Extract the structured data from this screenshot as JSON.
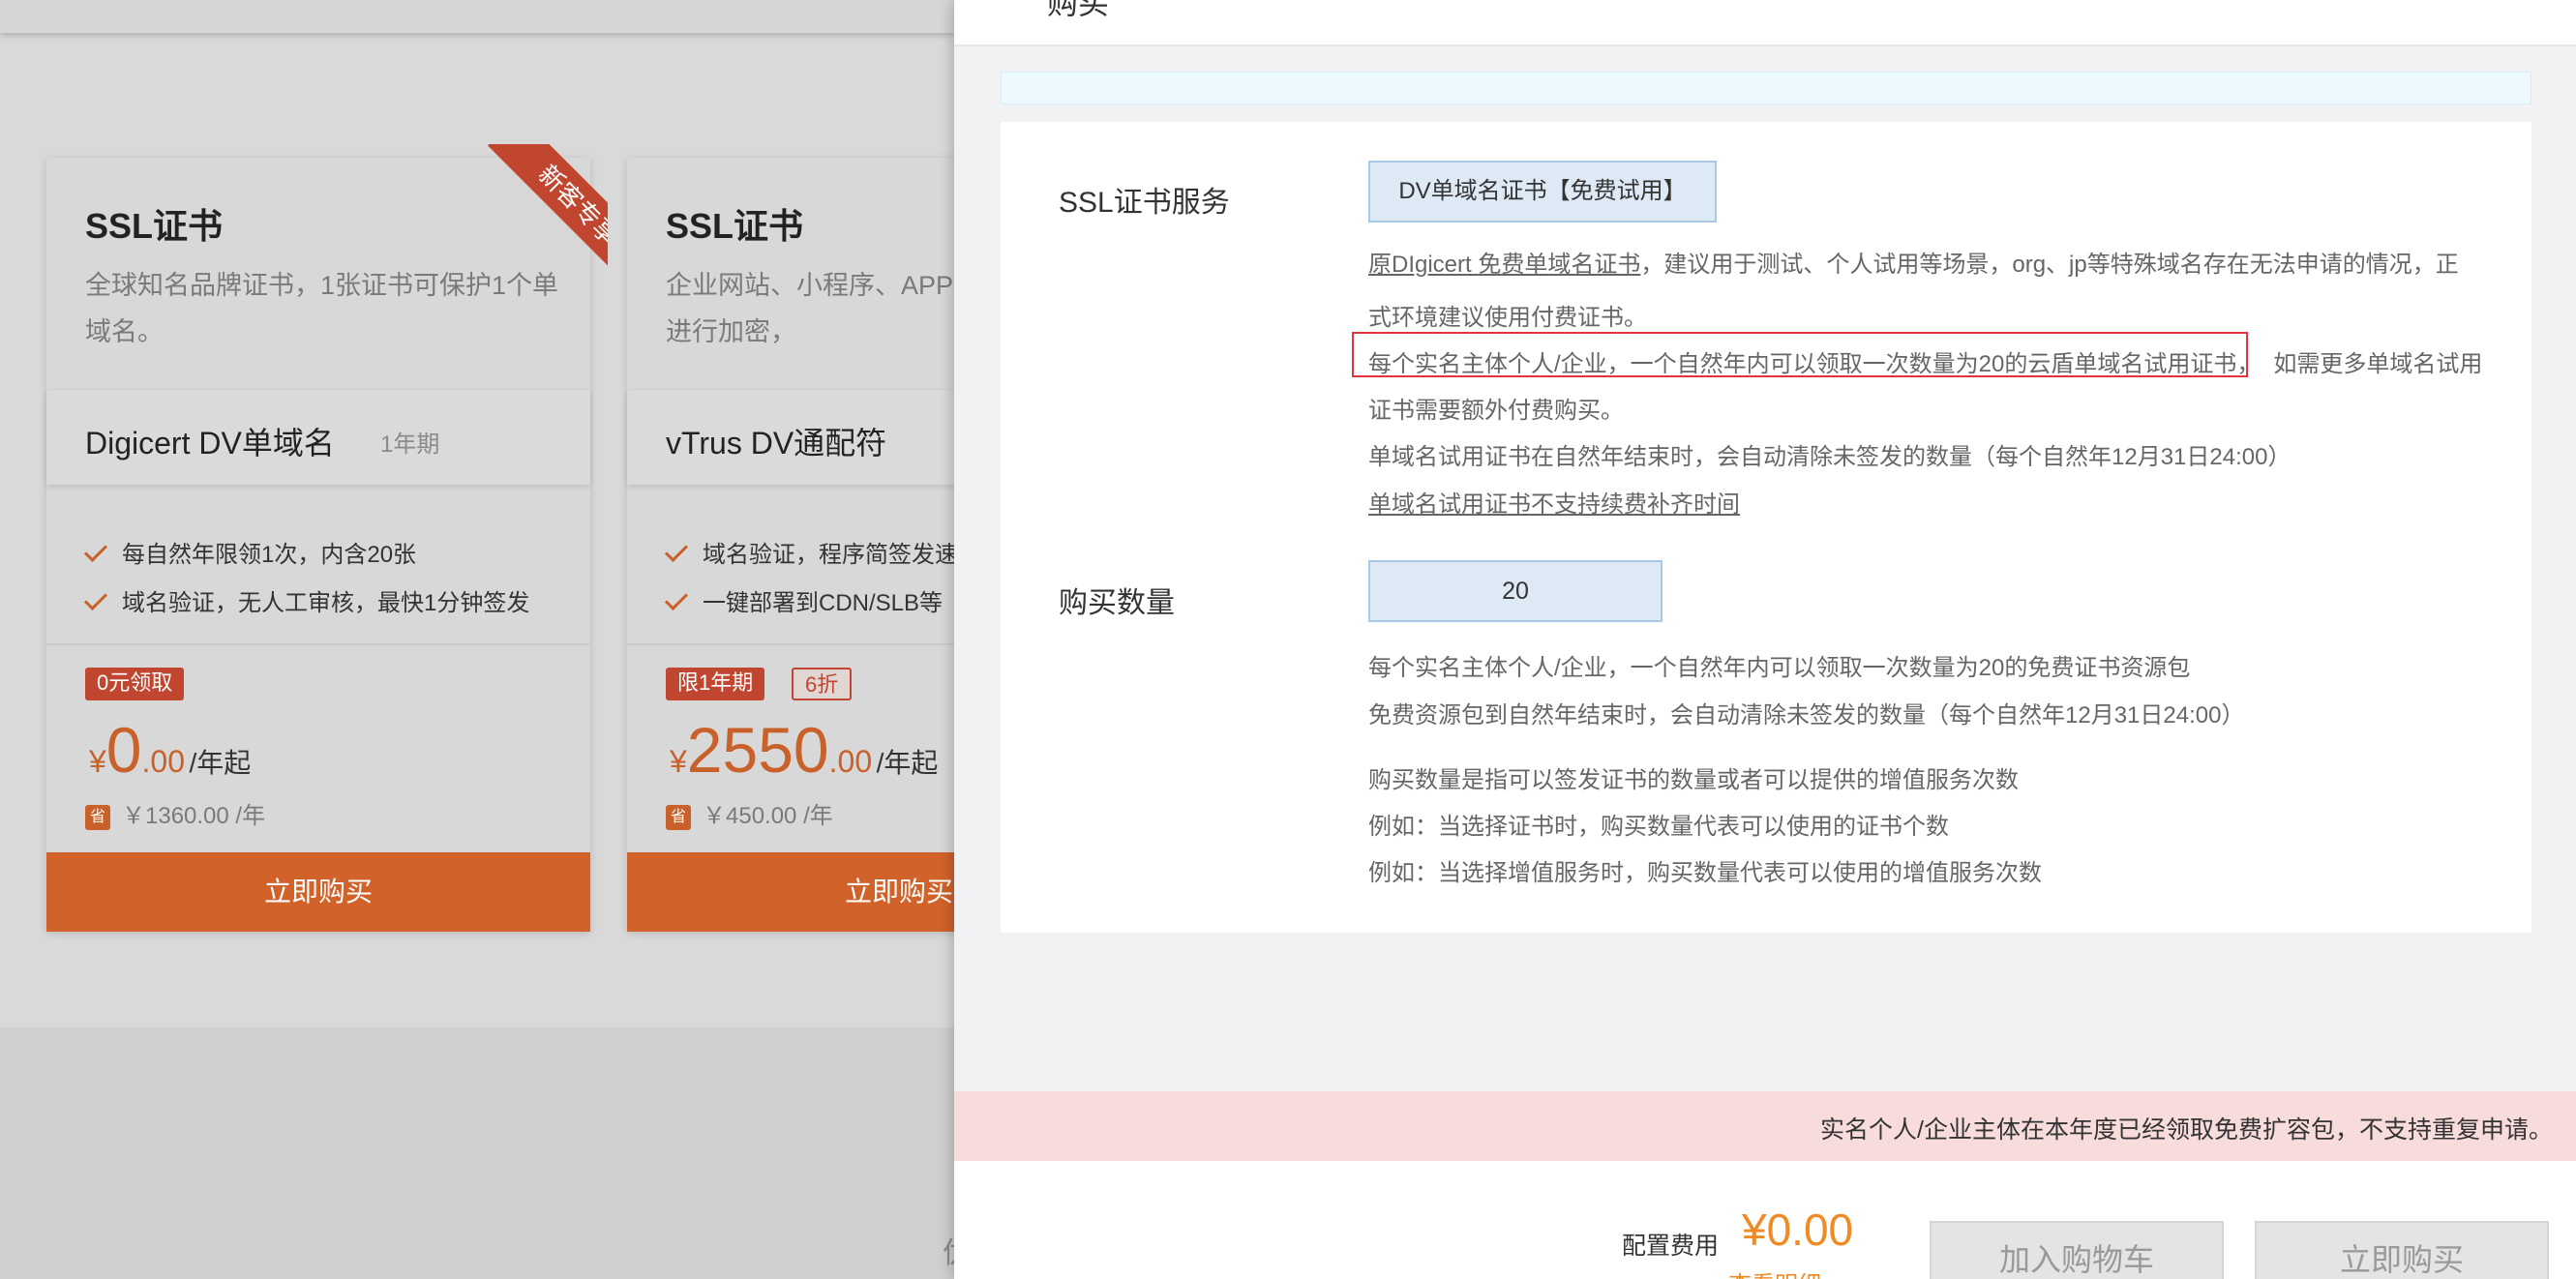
{
  "cards": [
    {
      "title": "SSL证书",
      "desc": "全球知名品牌证书，1张证书可保护1个单域名。",
      "ribbon": "新客专享",
      "product": "Digicert DV单域名",
      "period": "1年期",
      "features": [
        "每自然年限领1次，内含20张",
        "域名验证，无人工审核，最快1分钟签发"
      ],
      "badges": [
        "0元领取"
      ],
      "price_yen": "¥",
      "price_int": "0",
      "price_dec": ".00",
      "price_unit": "/年起",
      "save_icon": "省",
      "save_text": "￥1360.00 /年",
      "buy": "立即购买"
    },
    {
      "title": "SSL证书",
      "desc": "企业网站、小程序、APP 产品，对流量进行加密，",
      "product": "vTrus DV通配符",
      "features": [
        "域名验证，程序简签发速",
        "一键部署到CDN/SLB等"
      ],
      "badges": [
        "限1年期",
        "6折"
      ],
      "price_yen": "¥",
      "price_int": "2550",
      "price_dec": ".00",
      "price_unit": "/年起",
      "save_icon": "省",
      "save_text": "￥450.00 /年",
      "buy": "立即购买"
    }
  ],
  "bg_footer_char": "优",
  "drawer": {
    "title": "购买",
    "ssl_label": "SSL证书服务",
    "ssl_value": "DV单域名证书【免费试用】",
    "ssl_help": {
      "link": "原DIgicert 免费单域名证书",
      "line1_rest": "，建议用于测试、个人试用等场景，org、jp等特殊域名存在无法申请的情况，正",
      "line2": "式环境建议使用付费证书。",
      "line3_highlight": "每个实名主体个人/企业，一个自然年内可以领取一次数量为20的云盾单域名试用证书，",
      "line3_rest": "如需更多单域名试用",
      "line4": "证书需要额外付费购买。",
      "line5": "单域名试用证书在自然年结束时，会自动清除未签发的数量（每个自然年12月31日24:00）",
      "line6_link": "单域名试用证书不支持续费补齐时间"
    },
    "qty_label": "购买数量",
    "qty_value": "20",
    "qty_help": [
      "每个实名主体个人/企业，一个自然年内可以领取一次数量为20的免费证书资源包",
      "免费资源包到自然年结束时，会自动清除未签发的数量（每个自然年12月31日24:00）",
      "购买数量是指可以签发证书的数量或者可以提供的增值服务次数",
      "例如：当选择证书时，购买数量代表可以使用的证书个数",
      "例如：当选择增值服务时，购买数量代表可以使用的增值服务次数"
    ],
    "alert": "实名个人/企业主体在本年度已经领取免费扩容包，不支持重复申请。",
    "fee_label": "配置费用",
    "fee_amount": "¥0.00",
    "detail_link": "查看明细 ↓",
    "cart_button": "加入购物车",
    "buy_button": "立即购买"
  },
  "colors": {
    "accent_orange": "#d1622a",
    "badge_red": "#c14630",
    "fee_orange": "#f08a24",
    "alert_bg": "#f8dcdc",
    "highlight_border": "#e3333c"
  }
}
